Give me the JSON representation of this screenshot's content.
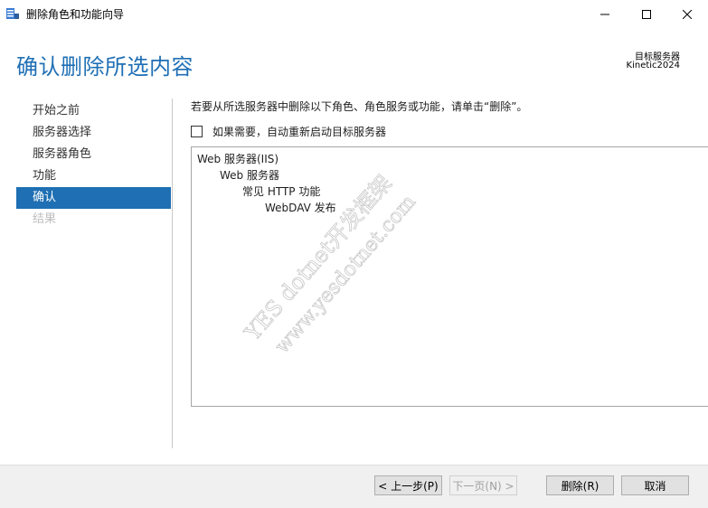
{
  "window": {
    "title": "删除角色和功能向导",
    "controls": {
      "minimize": "minimize-icon",
      "maximize": "maximize-icon",
      "close": "close-icon"
    }
  },
  "header": {
    "title": "确认删除所选内容",
    "target_label": "目标服务器",
    "target_value": "Kinetic2024"
  },
  "nav": {
    "items": [
      {
        "label": "开始之前",
        "state": "normal"
      },
      {
        "label": "服务器选择",
        "state": "normal"
      },
      {
        "label": "服务器角色",
        "state": "normal"
      },
      {
        "label": "功能",
        "state": "normal"
      },
      {
        "label": "确认",
        "state": "active"
      },
      {
        "label": "结果",
        "state": "disabled"
      }
    ]
  },
  "main": {
    "instruction": "若要从所选服务器中删除以下角色、角色服务或功能，请单击“删除”。",
    "restart_label": "如果需要，自动重新启动目标服务器",
    "restart_checked": false,
    "items": [
      {
        "text": "Web 服务器(IIS)",
        "level": 0
      },
      {
        "text": "Web 服务器",
        "level": 1
      },
      {
        "text": "常见 HTTP 功能",
        "level": 2
      },
      {
        "text": "WebDAV 发布",
        "level": 3
      }
    ]
  },
  "watermark": {
    "line1": "YES dotnet开发框架",
    "line2": "www.yesdotnet.com"
  },
  "footer": {
    "prev": "< 上一步(P)",
    "next": "下一页(N) >",
    "delete": "删除(R)",
    "cancel": "取消"
  },
  "colors": {
    "accent": "#1e6fb3",
    "title": "#1f6fb5",
    "footer_bg": "#f0f0f0"
  }
}
